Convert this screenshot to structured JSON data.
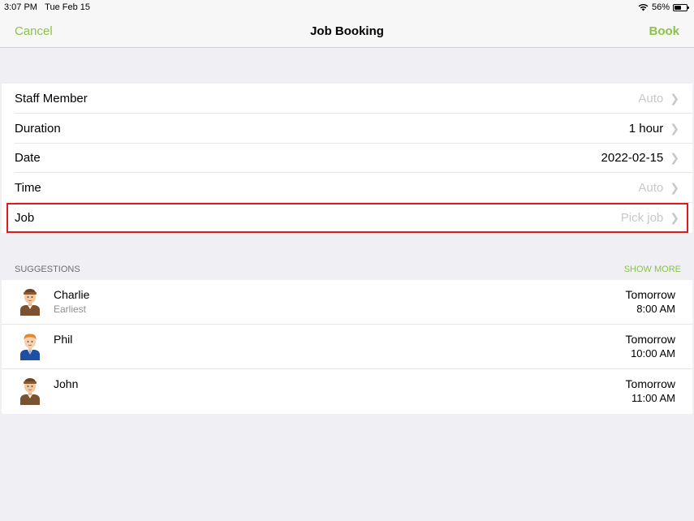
{
  "status_bar": {
    "time": "3:07 PM",
    "date": "Tue Feb 15",
    "battery": "56%",
    "battery_level": 0.56
  },
  "nav": {
    "cancel_label": "Cancel",
    "title": "Job Booking",
    "book_label": "Book"
  },
  "form": {
    "rows": [
      {
        "label": "Staff Member",
        "value": "Auto",
        "placeholder": true
      },
      {
        "label": "Duration",
        "value": "1 hour",
        "placeholder": false
      },
      {
        "label": "Date",
        "value": "2022-02-15",
        "placeholder": false
      },
      {
        "label": "Time",
        "value": "Auto",
        "placeholder": true
      },
      {
        "label": "Job",
        "value": "Pick job",
        "placeholder": true
      }
    ]
  },
  "suggestions": {
    "header": "SUGGESTIONS",
    "show_more": "SHOW MORE",
    "items": [
      {
        "name": "Charlie",
        "subtitle": "Earliest",
        "day": "Tomorrow",
        "time": "8:00 AM",
        "avatar": "staff-avatar-brown-uniform"
      },
      {
        "name": "Phil",
        "subtitle": "",
        "day": "Tomorrow",
        "time": "10:00 AM",
        "avatar": "staff-avatar-blue-suit"
      },
      {
        "name": "John",
        "subtitle": "",
        "day": "Tomorrow",
        "time": "11:00 AM",
        "avatar": "staff-avatar-brown-uniform"
      }
    ]
  },
  "colors": {
    "accent": "#8bc34a",
    "highlight": "#e0191f",
    "placeholder": "#c7c7cc",
    "background": "#efeff4"
  }
}
